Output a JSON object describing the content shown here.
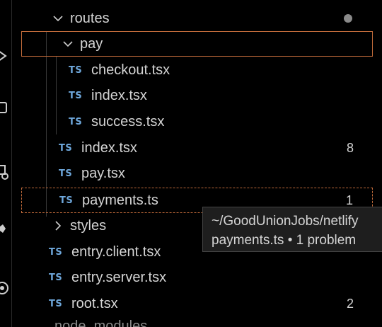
{
  "explorer": {
    "routes_folder": {
      "label": "routes",
      "icon": "chevron-down-icon",
      "modified_dot": true
    },
    "pay_folder": {
      "label": "pay",
      "icon": "chevron-down-icon"
    },
    "pay_files": [
      {
        "label": "checkout.tsx",
        "icon_text": "TS"
      },
      {
        "label": "index.tsx",
        "icon_text": "TS"
      },
      {
        "label": "success.tsx",
        "icon_text": "TS"
      }
    ],
    "routes_files": [
      {
        "label": "index.tsx",
        "icon_text": "TS",
        "badge": "8"
      },
      {
        "label": "pay.tsx",
        "icon_text": "TS",
        "badge": ""
      },
      {
        "label": "payments.ts",
        "icon_text": "TS",
        "badge": "1"
      }
    ],
    "styles_folder": {
      "label": "styles",
      "icon": "chevron-right-icon"
    },
    "app_files": [
      {
        "label": "entry.client.tsx",
        "icon_text": "TS",
        "badge": ""
      },
      {
        "label": "entry.server.tsx",
        "icon_text": "TS",
        "badge": ""
      },
      {
        "label": "root.tsx",
        "icon_text": "TS",
        "badge": "2"
      }
    ],
    "partial_row": {
      "label": "node_modules"
    }
  },
  "tooltip": {
    "path": "~/GoodUnionJobs/netlify",
    "summary": "payments.ts • 1 problem"
  },
  "colors": {
    "background": "#000000",
    "text": "#d4d4d4",
    "ts_icon": "#6fa8dc",
    "focus_border": "#c06a3a"
  }
}
